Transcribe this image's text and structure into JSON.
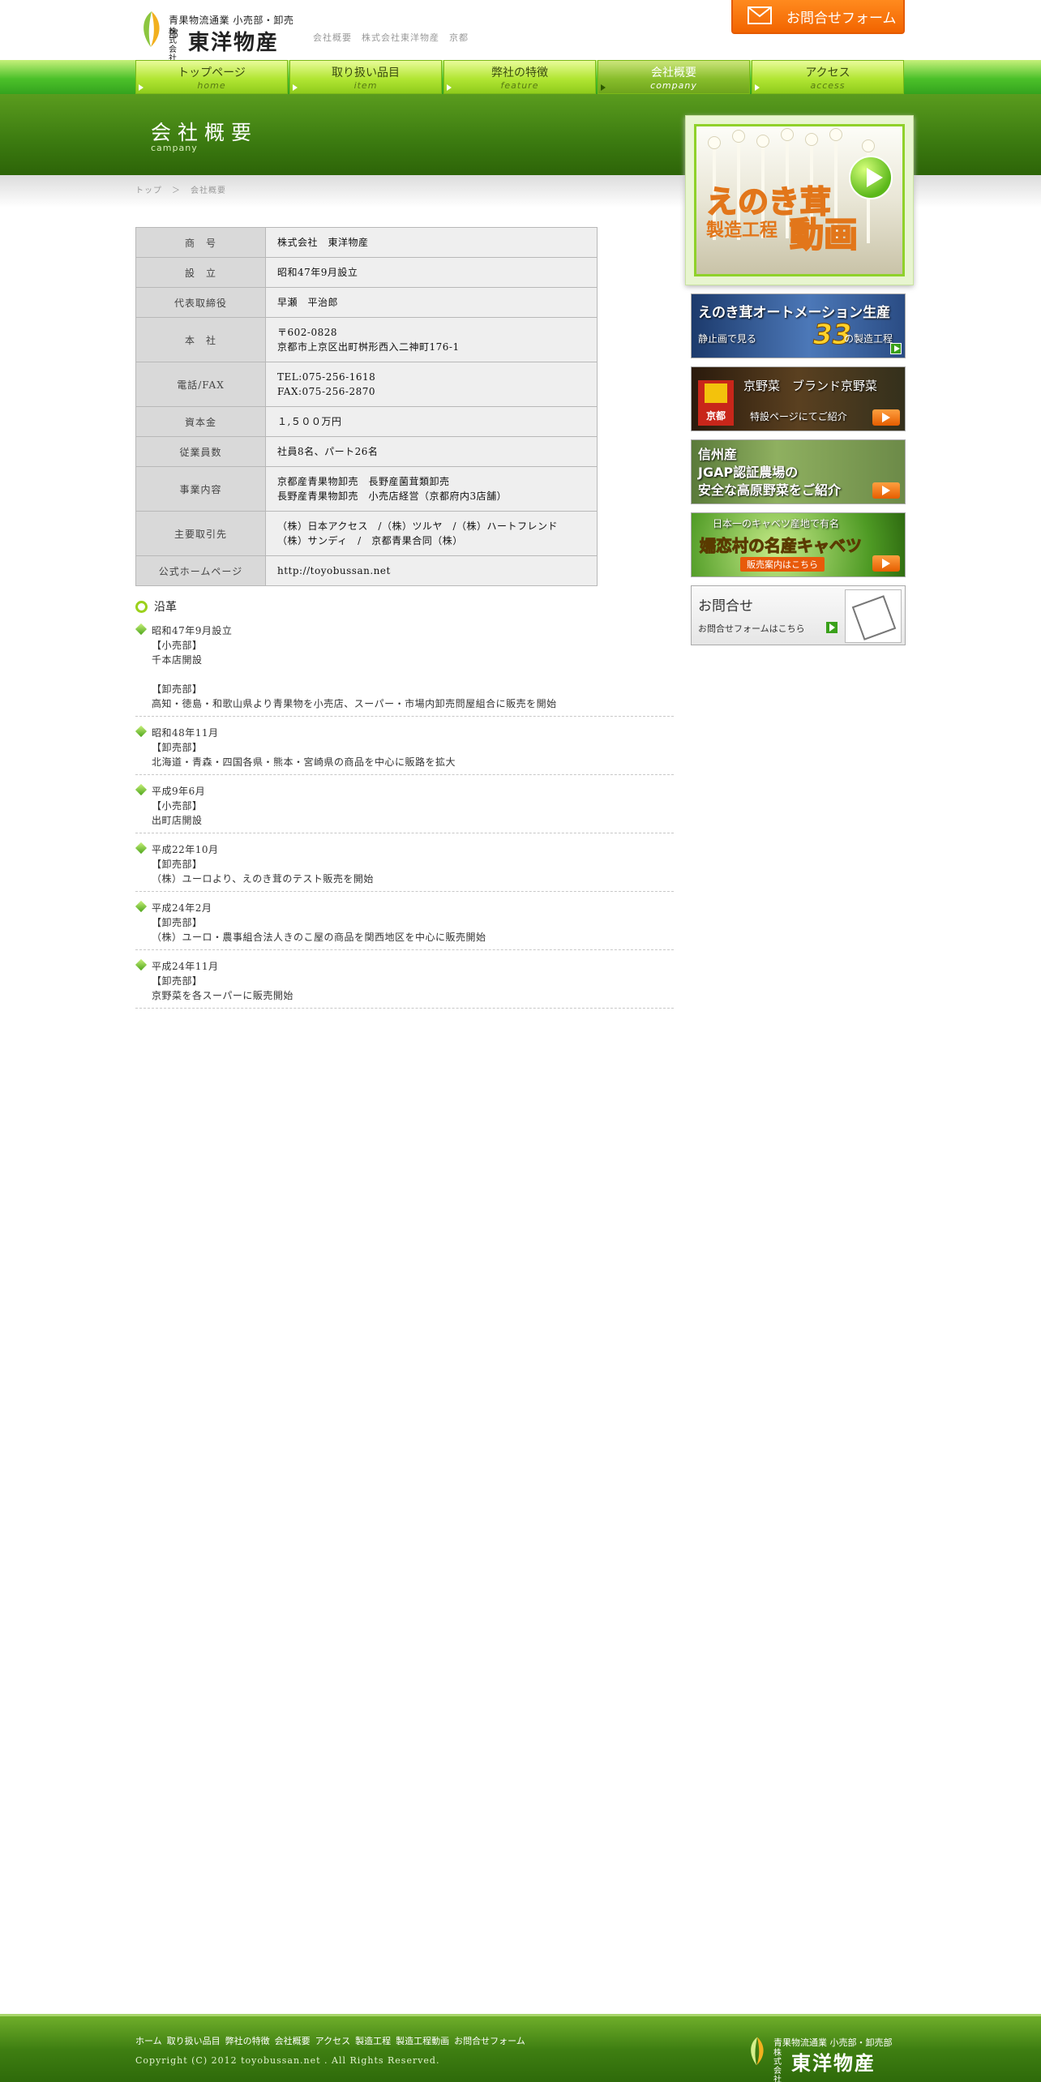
{
  "header": {
    "logo_tagline": "青果物流通業 小売部・卸売部",
    "logo_kabushiki": "株式会社",
    "logo_name": "東洋物産",
    "page_tagline": "会社概要　株式会社東洋物産　京都",
    "contact_button": "お問合せフォーム"
  },
  "nav": [
    {
      "jp": "トップページ",
      "en": "home",
      "active": false
    },
    {
      "jp": "取り扱い品目",
      "en": "item",
      "active": false
    },
    {
      "jp": "弊社の特徴",
      "en": "feature",
      "active": false
    },
    {
      "jp": "会社概要",
      "en": "company",
      "active": true
    },
    {
      "jp": "アクセス",
      "en": "access",
      "active": false
    }
  ],
  "page": {
    "title": "会社概要",
    "subtitle": "campany",
    "breadcrumb": [
      "トップ",
      "＞",
      "会社概要"
    ]
  },
  "company_table": [
    {
      "label": "商　号",
      "value": [
        "株式会社　東洋物産"
      ]
    },
    {
      "label": "設　立",
      "value": [
        "昭和47年9月設立"
      ]
    },
    {
      "label": "代表取締役",
      "value": [
        "早瀬　平治郎"
      ]
    },
    {
      "label": "本　社",
      "value": [
        "〒602-0828",
        "京都市上京区出町桝形西入二神町176-1"
      ]
    },
    {
      "label": "電話/FAX",
      "value": [
        "TEL:075-256-1618",
        "FAX:075-256-2870"
      ]
    },
    {
      "label": "資本金",
      "value": [
        "１,５００万円"
      ]
    },
    {
      "label": "従業員数",
      "value": [
        "社員8名、パート26名"
      ]
    },
    {
      "label": "事業内容",
      "value": [
        "京都産青果物卸売　長野産菌茸類卸売",
        "長野産青果物卸売　小売店経営（京都府内3店舗）"
      ]
    },
    {
      "label": "主要取引先",
      "value": [
        "（株）日本アクセス　/（株）ツルヤ　/（株）ハートフレンド",
        "（株）サンディ　/　京都青果合同（株）"
      ]
    },
    {
      "label": "公式ホームページ",
      "value": [
        "http://toyobussan.net"
      ]
    }
  ],
  "history": {
    "heading": "沿革",
    "items": [
      {
        "lines": [
          "昭和47年9月設立",
          "【小売部】",
          "千本店開設",
          "",
          "【卸売部】",
          "高知・徳島・和歌山県より青果物を小売店、スーパー・市場内卸売問屋組合に販売を開始"
        ]
      },
      {
        "lines": [
          "昭和48年11月",
          "【卸売部】",
          "北海道・青森・四国各県・熊本・宮崎県の商品を中心に販路を拡大"
        ]
      },
      {
        "lines": [
          "平成9年6月",
          "【小売部】",
          "出町店開設"
        ]
      },
      {
        "lines": [
          "平成22年10月",
          "【卸売部】",
          "（株）ユーロより、えのき茸のテスト販売を開始"
        ]
      },
      {
        "lines": [
          "平成24年2月",
          "【卸売部】",
          "（株）ユーロ・農事組合法人きのこ屋の商品を関西地区を中心に販売開始"
        ]
      },
      {
        "lines": [
          "平成24年11月",
          "【卸売部】",
          "京野菜を各スーパーに販売開始"
        ]
      }
    ]
  },
  "sidebar": {
    "video": {
      "l1": "えのき茸",
      "l2": "製造工程",
      "l3": "動画"
    },
    "automation": {
      "main": "えのき茸オートメーション生産",
      "sub": "静止画で見る",
      "num": "33",
      "tail": "の製造工程"
    },
    "kyoto": {
      "stamp": "京都",
      "main": "京野菜　ブランド京野菜",
      "sub": "特設ページにてご紹介"
    },
    "shinshu": {
      "l1": "信州産",
      "l2": "JGAP認証農場の",
      "l3": "安全な高原野菜をご紹介"
    },
    "cabbage": {
      "l1": "日本一のキャベツ産地で有名",
      "l2": "嬬恋村の名産キャベツ",
      "l3": "販売案内はこちら"
    },
    "inquiry": {
      "main": "お問合せ",
      "sub": "お問合せフォームはこちら"
    }
  },
  "footer": {
    "nav": [
      "ホーム",
      "取り扱い品目",
      "弊社の特徴",
      "会社概要",
      "アクセス",
      "製造工程",
      "製造工程動画",
      "お問合せフォーム"
    ],
    "copyright": "Copyright (C) 2012 toyobussan.net . All Rights Reserved.",
    "logo_tagline": "青果物流通業 小売部・卸売部",
    "logo_kabushiki": "株式会社",
    "logo_name": "東洋物産"
  },
  "colors": {
    "brand_green": "#5a9c1e",
    "accent_orange": "#f26400",
    "nav_lime": "#b2e634"
  }
}
